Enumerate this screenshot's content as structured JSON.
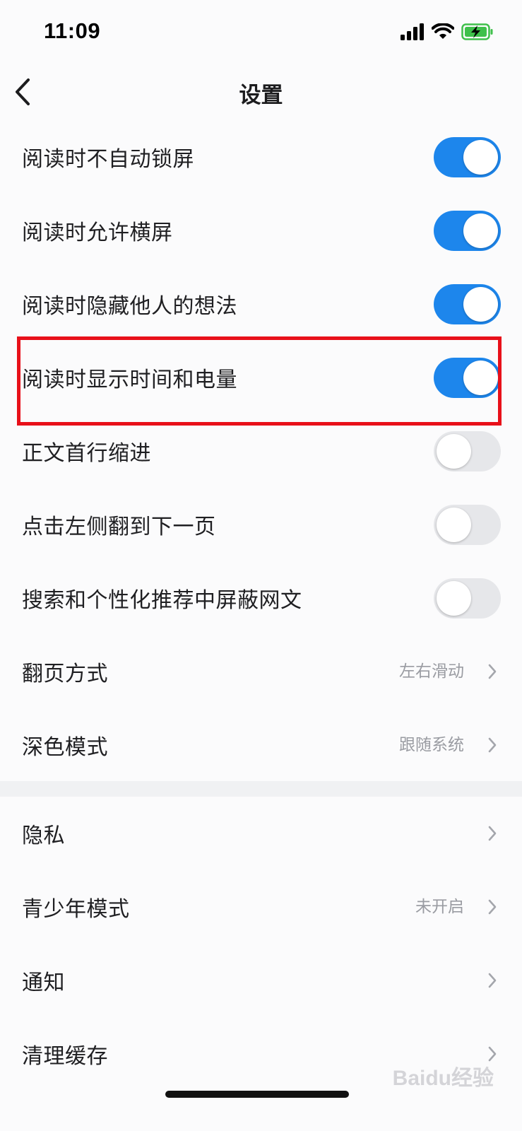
{
  "status_bar": {
    "time": "11:09"
  },
  "header": {
    "title": "设置"
  },
  "settings_toggles": [
    {
      "label": "阅读时不自动锁屏",
      "on": true
    },
    {
      "label": "阅读时允许横屏",
      "on": true
    },
    {
      "label": "阅读时隐藏他人的想法",
      "on": true
    },
    {
      "label": "阅读时显示时间和电量",
      "on": true
    },
    {
      "label": "正文首行缩进",
      "on": false
    },
    {
      "label": "点击左侧翻到下一页",
      "on": false
    },
    {
      "label": "搜索和个性化推荐中屏蔽网文",
      "on": false
    }
  ],
  "settings_select": [
    {
      "label": "翻页方式",
      "value": "左右滑动"
    },
    {
      "label": "深色模式",
      "value": "跟随系统"
    }
  ],
  "settings_links": [
    {
      "label": "隐私",
      "value": ""
    },
    {
      "label": "青少年模式",
      "value": "未开启"
    },
    {
      "label": "通知",
      "value": ""
    },
    {
      "label": "清理缓存",
      "value": ""
    }
  ],
  "watermark": "Baidu经验",
  "colors": {
    "toggle_on": "#1d86ec",
    "highlight": "#e8101a"
  }
}
